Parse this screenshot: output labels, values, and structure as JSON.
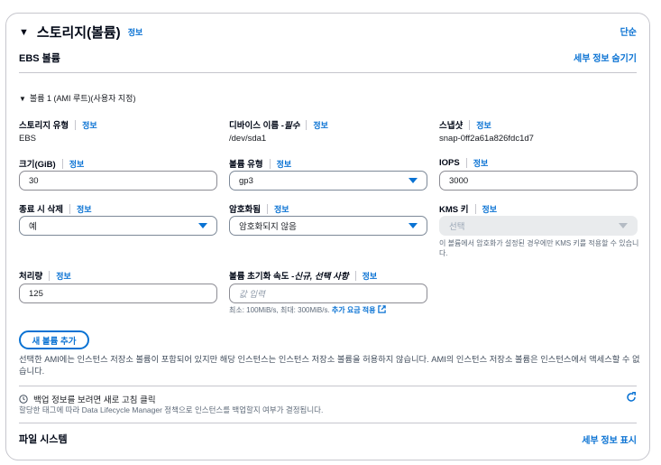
{
  "section": {
    "title": "스토리지(볼륨)",
    "info": "정보",
    "simple_link": "단순"
  },
  "ebs": {
    "title": "EBS 볼륨",
    "hide_details": "세부 정보 숨기기",
    "volume_header": "볼륨 1 (AMI 루트)(사용자 지정)"
  },
  "fields": {
    "storage_type": {
      "label": "스토리지 유형",
      "info": "정보",
      "value": "EBS"
    },
    "device_name": {
      "label_prefix": "디바이스 이름 - ",
      "label_em": "필수",
      "info": "정보",
      "value": "/dev/sda1"
    },
    "snapshot": {
      "label": "스냅샷",
      "info": "정보",
      "value": "snap-0ff2a61a826fdc1d7"
    },
    "size": {
      "label": "크기(GiB)",
      "info": "정보",
      "value": "30"
    },
    "volume_type": {
      "label": "볼륨 유형",
      "info": "정보",
      "value": "gp3"
    },
    "iops": {
      "label": "IOPS",
      "info": "정보",
      "value": "3000"
    },
    "delete_on_termination": {
      "label": "종료 시 삭제",
      "info": "정보",
      "value": "예"
    },
    "encrypted": {
      "label": "암호화됨",
      "info": "정보",
      "value": "암호화되지 않음"
    },
    "kms_key": {
      "label": "KMS 키",
      "info": "정보",
      "placeholder": "선택",
      "hint": "이 볼륨에서 암호화가 설정된 경우에만 KMS 키를 적용할 수 있습니다."
    },
    "throughput": {
      "label": "처리량",
      "info": "정보",
      "value": "125"
    },
    "init_rate": {
      "label_prefix": "볼륨 초기화 속도 - ",
      "label_em": "신규, 선택 사항",
      "info": "정보",
      "placeholder": "값 입력",
      "hint_text": "최소: 100MiB/s, 최대: 300MiB/s. ",
      "hint_link": "추가 요금 적용"
    }
  },
  "add_volume_label": "새 볼륨 추가",
  "ami_note": "선택한 AMI에는 인스턴스 저장소 볼륨이 포함되어 있지만 해당 인스턴스는 인스턴스 저장소 볼륨을 허용하지 않습니다. AMI의 인스턴스 저장소 볼륨은 인스턴스에서 액세스할 수 없습니다.",
  "backup": {
    "title": "백업 정보를 보려면 새로 고침 클릭",
    "description": "할당한 태그에 따라 Data Lifecycle Manager 정책으로 인스턴스를 백업할지 여부가 결정됩니다."
  },
  "filesystem": {
    "title": "파일 시스템",
    "show_details": "세부 정보 표시"
  },
  "colors": {
    "accent": "#0972d3",
    "border": "#c6c6cd",
    "text": "#000716"
  }
}
